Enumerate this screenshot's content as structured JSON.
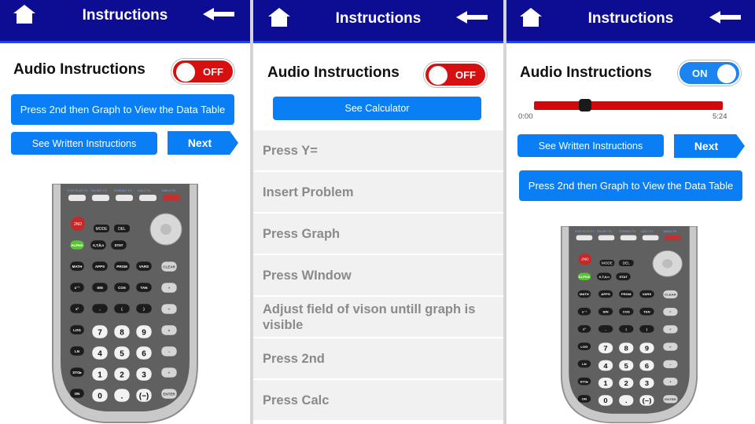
{
  "panel1": {
    "header": {
      "title": "Instructions",
      "home_icon": "home-icon",
      "back_icon": "arrow-left-icon"
    },
    "audio": {
      "label": "Audio Instructions",
      "toggle_text": "OFF",
      "toggle_state": "off"
    },
    "buttons": {
      "data_table": "Press 2nd then Graph to View the Data Table",
      "written": "See Written Instructions",
      "next": "Next"
    }
  },
  "panel2": {
    "header": {
      "title": "Instructions",
      "home_icon": "home-icon",
      "back_icon": "arrow-left-icon"
    },
    "audio": {
      "label": "Audio Instructions",
      "toggle_text": "OFF",
      "toggle_state": "off"
    },
    "buttons": {
      "calculator": "See Calculator"
    },
    "steps": [
      "Press Y=",
      "Insert Problem",
      "Press Graph",
      "Press WIndow",
      "Adjust field of vison untill graph is visible",
      "Press 2nd",
      "Press Calc"
    ]
  },
  "panel3": {
    "header": {
      "title": "Instructions",
      "home_icon": "home-icon",
      "back_icon": "arrow-left-icon"
    },
    "audio": {
      "label": "Audio Instructions",
      "toggle_text": "ON",
      "toggle_state": "on"
    },
    "player": {
      "current_time": "0:00",
      "duration": "5:24",
      "progress": 0.27
    },
    "buttons": {
      "written": "See Written Instructions",
      "next": "Next",
      "data_table": "Press 2nd then Graph to View the Data Table"
    }
  },
  "calculator": {
    "top_keys": [
      "STAT PLOT F1",
      "TBLSET F2",
      "FORMAT F3",
      "CALC F4",
      "TABLE F5"
    ],
    "row_keys": [
      [
        "ALPHA",
        "X,T,θ,n",
        "STAT"
      ],
      [
        "MATH",
        "APPS",
        "PRGM",
        "VARS",
        "CLEAR"
      ],
      [
        "x⁻¹",
        "SIN",
        "COS",
        "TAN",
        "^"
      ],
      [
        "x²",
        ",",
        "(",
        ")",
        "÷"
      ],
      [
        "LOG",
        "7",
        "8",
        "9",
        "×"
      ],
      [
        "LN",
        "4",
        "5",
        "6",
        "−"
      ],
      [
        "STO▸",
        "1",
        "2",
        "3",
        "+"
      ],
      [
        "ON",
        "0",
        ".",
        "(−)",
        "ENTER"
      ]
    ],
    "misc_keys": [
      "2ND",
      "MODE",
      "DEL"
    ]
  },
  "colors": {
    "header_bg": "#0d0d94",
    "button_blue": "#0a7ff5",
    "toggle_off": "#d60f10",
    "toggle_on": "#1b84f0"
  }
}
